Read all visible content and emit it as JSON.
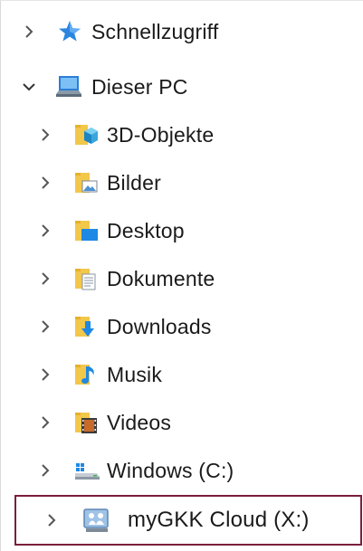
{
  "nav": {
    "quick_access": {
      "label": "Schnellzugriff",
      "icon": "star-icon",
      "expanded": false
    },
    "this_pc": {
      "label": "Dieser PC",
      "icon": "computer-icon",
      "expanded": true
    },
    "children": [
      {
        "label": "3D-Objekte",
        "icon": "3d-objects-folder-icon"
      },
      {
        "label": "Bilder",
        "icon": "pictures-folder-icon"
      },
      {
        "label": "Desktop",
        "icon": "desktop-folder-icon"
      },
      {
        "label": "Dokumente",
        "icon": "documents-folder-icon"
      },
      {
        "label": "Downloads",
        "icon": "downloads-folder-icon"
      },
      {
        "label": "Musik",
        "icon": "music-folder-icon"
      },
      {
        "label": "Videos",
        "icon": "videos-folder-icon"
      },
      {
        "label": "Windows (C:)",
        "icon": "drive-icon"
      }
    ],
    "cloud_drive": {
      "label": "myGKK Cloud (X:)",
      "icon": "network-drive-icon",
      "highlighted": true
    }
  },
  "colors": {
    "folder": "#f2c74a",
    "accent_blue": "#1e88e5",
    "highlight_border": "#7b1f3c",
    "chevron": "#555555"
  }
}
